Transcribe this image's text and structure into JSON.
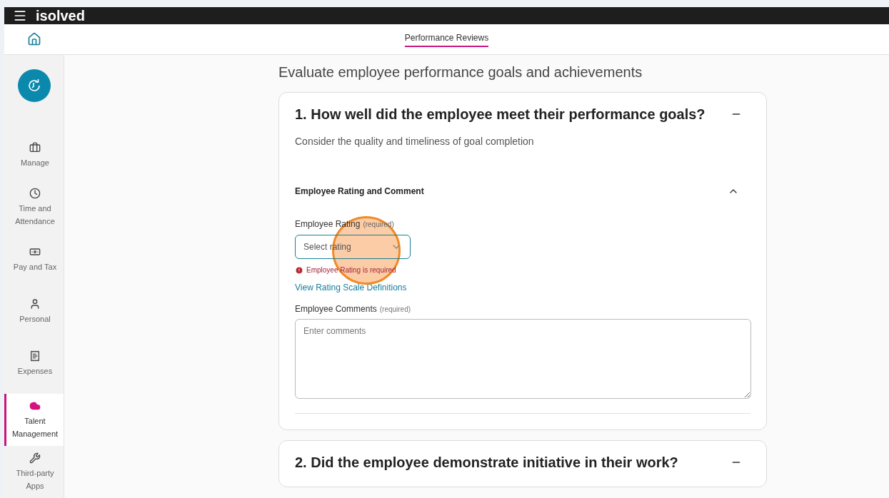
{
  "header": {
    "logo": "isolved",
    "tabs": [
      {
        "label": "Performance Reviews",
        "selected": true
      }
    ]
  },
  "sidebar": {
    "items": [
      {
        "kind": "briefcase",
        "label": "Manage",
        "selected": false
      },
      {
        "kind": "clock",
        "label": "Time and Attendance",
        "selected": false
      },
      {
        "kind": "money",
        "label": "Pay and Tax",
        "selected": false
      },
      {
        "kind": "person",
        "label": "Personal",
        "selected": false
      },
      {
        "kind": "receipt",
        "label": "Expenses",
        "selected": false
      },
      {
        "kind": "cloud",
        "label": "Talent Management",
        "selected": true
      },
      {
        "kind": "tools",
        "label": "Third-party Apps",
        "selected": false
      }
    ]
  },
  "page": {
    "heading": "Evaluate employee performance goals and achievements",
    "questions": [
      {
        "title": "1. How well did the employee meet their performance goals?",
        "expanded": true,
        "description": "Consider the quality and timeliness of goal completion",
        "section": {
          "title": "Employee Rating and Comment",
          "expanded": true,
          "rating": {
            "label": "Employee Rating",
            "hint": "(required)",
            "placeholder": "Select rating",
            "error": "Employee Rating is required"
          },
          "link": "View Rating Scale Definitions",
          "comments": {
            "label": "Employee Comments",
            "hint": "(required)",
            "placeholder": "Enter comments"
          }
        }
      },
      {
        "title": "2. Did the employee demonstrate initiative in their work?",
        "expanded": true
      }
    ]
  },
  "click_highlight": true
}
